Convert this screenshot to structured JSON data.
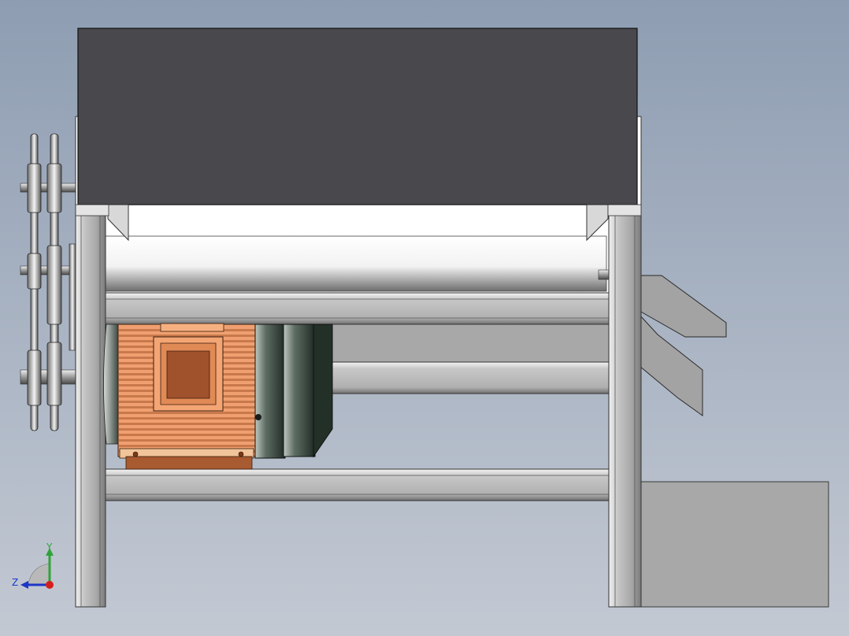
{
  "viewport": {
    "background_top": "#8e9db2",
    "background_bottom": "#c3c9d3"
  },
  "colors": {
    "hopper": "#49484d",
    "frame": "#c9c9c9",
    "frame_dark": "#8f8f8f",
    "roller": "#e8e8e8",
    "motor_body": "#f0a070",
    "motor_dark": "#a85a30",
    "motor_end": "#38463d",
    "chute": "#a3a3a3",
    "box": "#a8a8a8"
  },
  "triad": {
    "y_label": "Y",
    "z_label": "Z",
    "y_axis_color": "#2fa33a",
    "z_axis_color": "#1e36c8",
    "x_axis_color": "#d41e1e"
  }
}
